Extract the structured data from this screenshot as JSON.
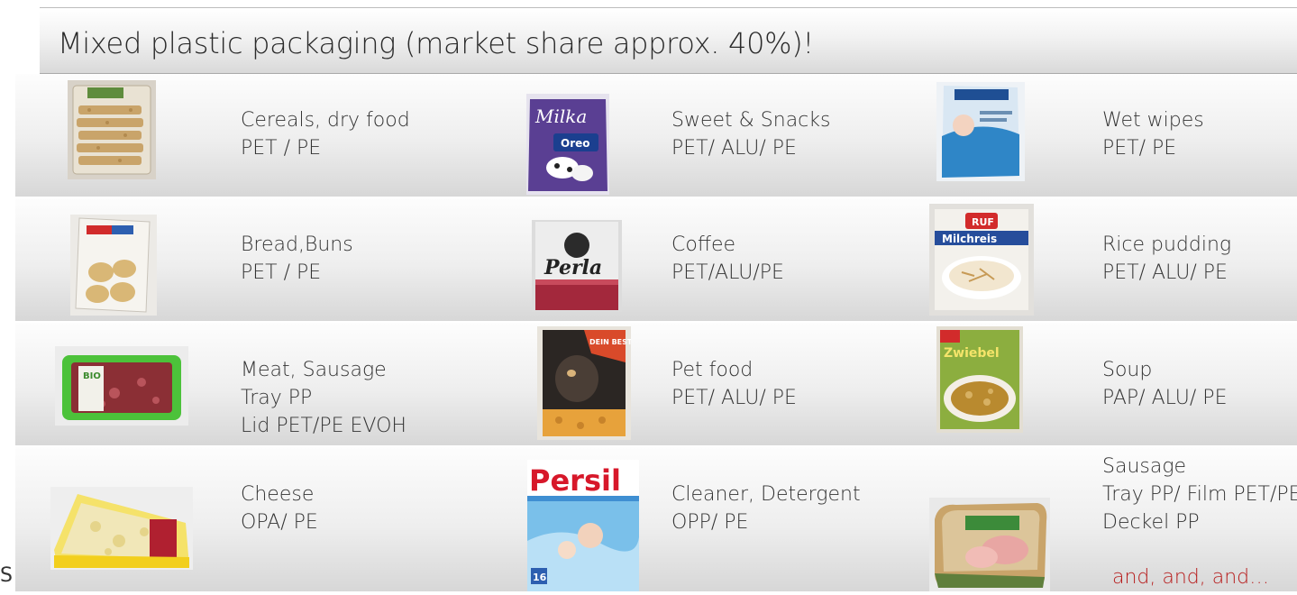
{
  "title": "Mixed plastic packaging (market share approx. 40%)!",
  "page_mark": "S",
  "footer_note": "and, and, and…",
  "items": [
    {
      "name": "Cereals, dry food",
      "materials": [
        "PET / PE"
      ]
    },
    {
      "name": "Sweet & Snacks",
      "materials": [
        "PET/ ALU/ PE"
      ]
    },
    {
      "name": "Wet wipes",
      "materials": [
        "PET/ PE"
      ]
    },
    {
      "name": "Bread,Buns",
      "materials": [
        "PET / PE"
      ]
    },
    {
      "name": "Coffee",
      "materials": [
        "PET/ALU/PE"
      ]
    },
    {
      "name": "Rice pudding",
      "materials": [
        "PET/ ALU/ PE"
      ]
    },
    {
      "name": "Meat, Sausage",
      "materials": [
        "Tray PP",
        "Lid PET/PE EVOH"
      ]
    },
    {
      "name": "Pet food",
      "materials": [
        "PET/ ALU/ PE"
      ]
    },
    {
      "name": "Soup",
      "materials": [
        "PAP/ ALU/ PE"
      ]
    },
    {
      "name": "Cheese",
      "materials": [
        "OPA/ PE"
      ]
    },
    {
      "name": "Cleaner, Detergent",
      "materials": [
        "OPP/ PE"
      ]
    },
    {
      "name": "Sausage",
      "materials": [
        "Tray PP/ Film PET/PE",
        "Deckel PP"
      ]
    }
  ],
  "images": {
    "milka_brand": "Milka",
    "oreo_brand": "Oreo",
    "perla_brand": "Perla",
    "ruf_brand": "RUF",
    "milchreis_label": "Milchreis",
    "zwiebel_label": "Zwiebel",
    "bio_label": "BIO",
    "persil_brand": "Persil",
    "persil_badge": "16",
    "petfood_label": "DEIN BESTES"
  }
}
